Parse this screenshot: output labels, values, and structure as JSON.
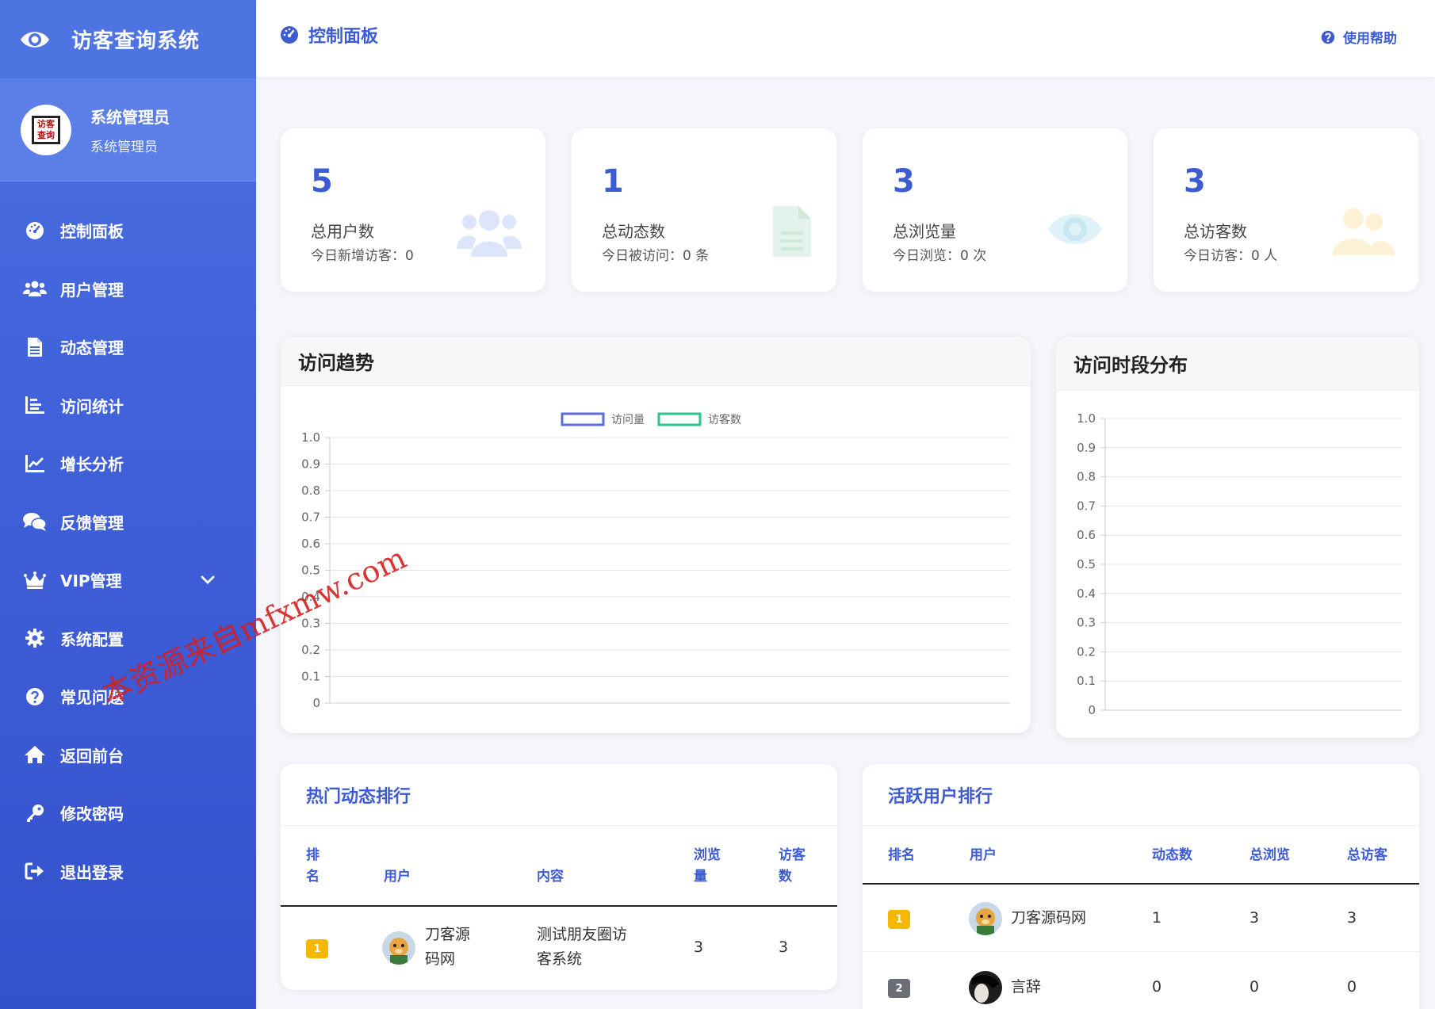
{
  "app": {
    "title": "访客查询系统"
  },
  "profile": {
    "avatar_text": "访客查询",
    "name": "系统管理员",
    "role": "系统管理员"
  },
  "menu": [
    {
      "label": "控制面板",
      "icon": "dashboard-icon"
    },
    {
      "label": "用户管理",
      "icon": "users-icon"
    },
    {
      "label": "动态管理",
      "icon": "file-icon"
    },
    {
      "label": "访问统计",
      "icon": "bar-list-icon"
    },
    {
      "label": "增长分析",
      "icon": "line-chart-icon"
    },
    {
      "label": "反馈管理",
      "icon": "comments-icon"
    },
    {
      "label": "VIP管理",
      "icon": "crown-icon"
    },
    {
      "label": "系统配置",
      "icon": "gear-icon"
    },
    {
      "label": "常见问题",
      "icon": "question-icon"
    },
    {
      "label": "返回前台",
      "icon": "home-icon"
    },
    {
      "label": "修改密码",
      "icon": "key-icon"
    },
    {
      "label": "退出登录",
      "icon": "logout-icon"
    }
  ],
  "header": {
    "title": "控制面板",
    "help": "使用帮助"
  },
  "stats": [
    {
      "value": "5",
      "label": "总用户数",
      "sub": "今日新增访客：0",
      "icon": "users-icon",
      "icon_color": "#dde5fb"
    },
    {
      "value": "1",
      "label": "总动态数",
      "sub": "今日被访问：0 条",
      "icon": "file-icon",
      "icon_color": "#e3f2ea"
    },
    {
      "value": "3",
      "label": "总浏览量",
      "sub": "今日浏览：0 次",
      "icon": "eye-icon",
      "icon_color": "#dff2f8"
    },
    {
      "value": "3",
      "label": "总访客数",
      "sub": "今日访客：0 人",
      "icon": "users-icon",
      "icon_color": "#fdf2d6"
    }
  ],
  "charts": {
    "trend": {
      "title": "访问趋势"
    },
    "hours": {
      "title": "访问时段分布"
    }
  },
  "chart_data": [
    {
      "type": "line",
      "title": "访问趋势",
      "ylim": [
        0,
        1.0
      ],
      "y_ticks": [
        "0",
        "0.1",
        "0.2",
        "0.3",
        "0.4",
        "0.5",
        "0.6",
        "0.7",
        "0.8",
        "0.9",
        "1.0"
      ],
      "series": [
        {
          "name": "访问量",
          "values": [],
          "color": "#5b6ed6"
        },
        {
          "name": "访客数",
          "values": [],
          "color": "#2ec28f"
        }
      ],
      "legend": "top",
      "grid": true
    },
    {
      "type": "bar",
      "title": "访问时段分布",
      "ylim": [
        0,
        1.0
      ],
      "y_ticks": [
        "0",
        "0.1",
        "0.2",
        "0.3",
        "0.4",
        "0.5",
        "0.6",
        "0.7",
        "0.8",
        "0.9",
        "1.0"
      ],
      "series": [],
      "grid": true
    }
  ],
  "hot_posts": {
    "title": "热门动态排行",
    "columns": {
      "rank_a": "排",
      "rank_b": "名",
      "user": "用户",
      "content": "内容",
      "views_a": "浏览",
      "views_b": "量",
      "visitors_a": "访客",
      "visitors_b": "数"
    },
    "rows": [
      {
        "rank": "1",
        "user_a": "刀客源",
        "user_b": "码网",
        "content_a": "测试朋友圈访",
        "content_b": "客系统",
        "views": "3",
        "visitors": "3"
      }
    ]
  },
  "active_users": {
    "title": "活跃用户排行",
    "columns": {
      "rank": "排名",
      "user": "用户",
      "posts": "动态数",
      "views": "总浏览",
      "visitors": "总访客"
    },
    "rows": [
      {
        "rank": "1",
        "user": "刀客源码网",
        "posts": "1",
        "views": "3",
        "visitors": "3"
      },
      {
        "rank": "2",
        "user": "言辞",
        "posts": "0",
        "views": "0",
        "visitors": "0"
      }
    ]
  },
  "watermark": "本资源来自mfxmw.com",
  "colors": {
    "primary": "#3d5bd3",
    "sidebar": "#4a6fe0",
    "gold": "#f5b800"
  }
}
